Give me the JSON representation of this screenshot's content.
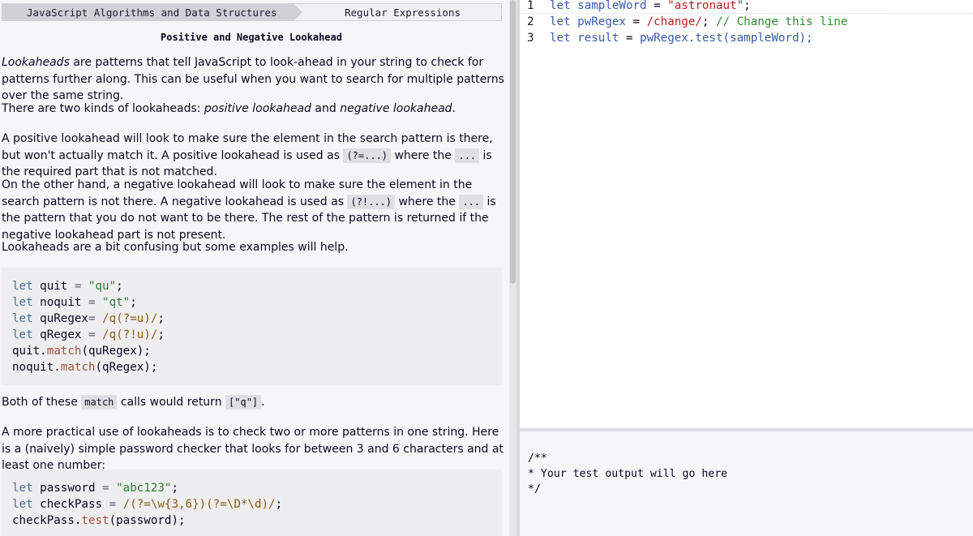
{
  "breadcrumb": {
    "superblock": "JavaScript Algorithms and Data Structures",
    "block": "Regular Expressions"
  },
  "challenge": {
    "title": "Positive and Negative Lookahead",
    "p1_em": "Lookaheads",
    "p1_rest": " are patterns that tell JavaScript to look-ahead in your string to check for patterns further along. This can be useful when you want to search for multiple patterns over the same string.",
    "p2_a": "There are two kinds of lookaheads: ",
    "p2_em1": "positive lookahead",
    "p2_b": " and ",
    "p2_em2": "negative lookahead",
    "p2_c": ".",
    "p3_a": "A positive lookahead will look to make sure the element in the search pattern is there, but won't actually match it. A positive lookahead is used as ",
    "p3_code1": "(?=...)",
    "p3_b": " where the ",
    "p3_code2": "...",
    "p3_c": " is the required part that is not matched.",
    "p4_a": "On the other hand, a negative lookahead will look to make sure the element in the search pattern is not there. A negative lookahead is used as ",
    "p4_code1": "(?!...)",
    "p4_b": " where the ",
    "p4_code2": "...",
    "p4_c": " is the pattern that you do not want to be there. The rest of the pattern is returned if the negative lookahead part is not present.",
    "p5": "Lookaheads are a bit confusing but some examples will help.",
    "p6_a": "Both of these ",
    "p6_code1": "match",
    "p6_b": " calls would return ",
    "p6_code2": "[\"q\"]",
    "p6_c": ".",
    "p7": "A more practical use of lookaheads is to check two or more patterns in one string. Here is a (naively) simple password checker that looks for between 3 and 6 characters and at least one number:",
    "example1": {
      "l1_kw": "let",
      "l1_id": " quit ",
      "l1_op": "=",
      "l1_str": " \"qu\"",
      "l1_end": ";",
      "l2_kw": "let",
      "l2_id": " noquit ",
      "l2_op": "=",
      "l2_str": " \"qt\"",
      "l2_end": ";",
      "l3_kw": "let",
      "l3_id": " quRegex",
      "l3_op": "=",
      "l3_rx": " /q(?=u)/",
      "l3_end": ";",
      "l4_kw": "let",
      "l4_id": " qRegex ",
      "l4_op": "=",
      "l4_rx": " /q(?!u)/",
      "l4_end": ";",
      "l5_obj": "quit.",
      "l5_fn": "match",
      "l5_args": "(quRegex);",
      "l6_obj": "noquit.",
      "l6_fn": "match",
      "l6_args": "(qRegex);"
    },
    "example2": {
      "l1_kw": "let",
      "l1_id": " password ",
      "l1_op": "=",
      "l1_str": " \"abc123\"",
      "l1_end": ";",
      "l2_kw": "let",
      "l2_id": " checkPass ",
      "l2_op": "=",
      "l2_rx": " /(?=\\w{3,6})(?=\\D*\\d)/",
      "l2_end": ";",
      "l3_obj": "checkPass.",
      "l3_fn": "test",
      "l3_args": "(password);"
    }
  },
  "editor": {
    "lines": [
      {
        "number": "1",
        "kw": "let",
        "id": " sampleWord ",
        "op": "=",
        "val": " \"astronaut\"",
        "end": ";"
      },
      {
        "number": "2",
        "kw": "let",
        "id": " pwRegex ",
        "op": "=",
        "val": " /change/",
        "end": ";",
        "comment": " // Change this line"
      },
      {
        "number": "3",
        "kw": "let",
        "id": " result ",
        "op": "=",
        "rest": " pwRegex.test(sampleWord);"
      }
    ]
  },
  "output": {
    "text": "/**\n* Your test output will go here\n*/"
  }
}
